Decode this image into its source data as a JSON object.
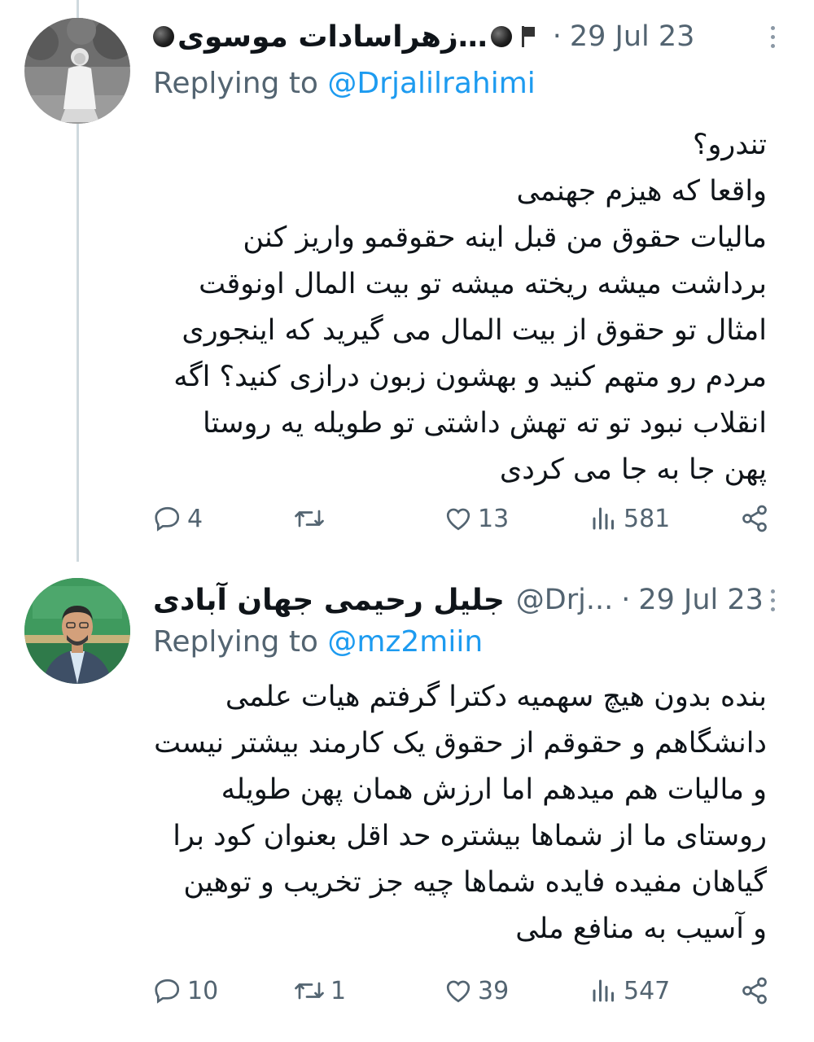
{
  "tweets": [
    {
      "display_name": "زهراسادات موسوی…",
      "date": "29 Jul 23",
      "replying_prefix": "Replying to",
      "replying_to": "@Drjalilrahimi",
      "body_lines": [
        "تندرو؟",
        "واقعا که هیزم جهنمی",
        "مالیات حقوق من قبل اینه حقوقمو واریز کنن",
        "برداشت میشه ریخته میشه تو بیت المال اونوقت",
        "امثال تو حقوق از بیت المال می گیرید که اینجوری",
        "مردم رو متهم کنید و بهشون زبون درازی کنید؟ اگه",
        "انقلاب نبود تو ته تهش داشتی تو طویله یه روستا",
        "پهن جا به جا می کردی"
      ],
      "stats": {
        "replies": "4",
        "retweets": "",
        "likes": "13",
        "views": "581"
      }
    },
    {
      "display_name": "جلیل رحیمی جهان آبادی",
      "handle": "@Drj...",
      "date": "29 Jul 23",
      "replying_prefix": "Replying to",
      "replying_to": "@mz2miin",
      "body_lines": [
        "بنده بدون هیچ سهمیه دکترا گرفتم هیات علمی",
        "دانشگاهم و حقوقم از حقوق یک کارمند بیشتر نیست",
        "و مالیات هم میدهم اما ارزش همان پهن طویله",
        "روستای ما از شماها بیشتره حد اقل بعنوان کود برا",
        "گیاهان مفیده فایده شماها چیه جز تخریب و توهین",
        "و آسیب به منافع ملی"
      ],
      "stats": {
        "replies": "10",
        "retweets": "1",
        "likes": "39",
        "views": "547"
      }
    }
  ],
  "icons": [
    "reply-icon",
    "retweet-icon",
    "like-icon",
    "views-icon",
    "share-icon",
    "more-icon",
    "flag-icon"
  ],
  "colors": {
    "link": "#1d9bf0",
    "secondary": "#536471",
    "thread_line": "#cfd9de"
  }
}
